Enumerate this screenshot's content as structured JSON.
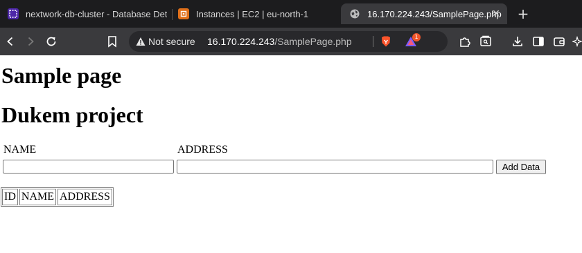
{
  "browser": {
    "tabs": [
      {
        "title": "nextwork-db-cluster - Database Deta",
        "favicon": "rds-icon",
        "active": false
      },
      {
        "title": "Instances | EC2 | eu-north-1",
        "favicon": "ec2-icon",
        "active": false
      },
      {
        "title": "16.170.224.243/SamplePage.php",
        "favicon": "globe-icon",
        "active": true
      }
    ],
    "tab_close_glyph": "✕",
    "new_tab_glyph": "+",
    "security_label": "Not secure",
    "url_host": "16.170.224.243",
    "url_path": "/SamplePage.php",
    "rewards_badge": "1",
    "colors": {
      "tabstrip": "#1c1c1e",
      "toolbar": "#3a3a3d",
      "omnibox": "#28282b",
      "brave_orange": "#fb542b"
    }
  },
  "page": {
    "title": "Sample page",
    "subtitle": "Dukem project",
    "form": {
      "name_label": "NAME",
      "address_label": "ADDRESS",
      "name_value": "",
      "address_value": "",
      "submit_label": "Add Data"
    },
    "table": {
      "headers": [
        "ID",
        "NAME",
        "ADDRESS"
      ],
      "rows": []
    }
  }
}
